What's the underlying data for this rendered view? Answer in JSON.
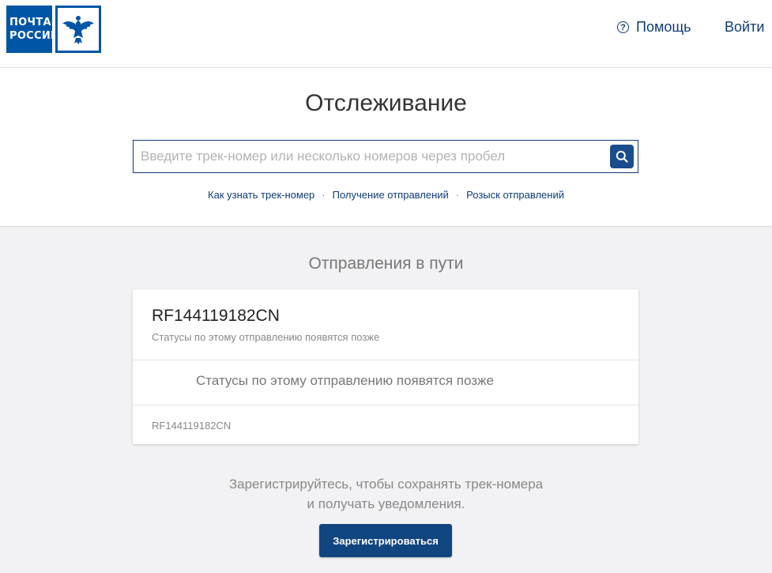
{
  "header": {
    "logo_line1": "ПОЧТА",
    "logo_line2": "РОССИИ",
    "help_label": "Помощь",
    "login_label": "Войти"
  },
  "tracking": {
    "title": "Отслеживание",
    "search_placeholder": "Введите трек-номер или несколько номеров через пробел",
    "links": [
      "Как узнать трек-номер",
      "Получение отправлений",
      "Розыск отправлений"
    ]
  },
  "shipments": {
    "section_title": "Отправления в пути",
    "card": {
      "track_number": "RF144119182CN",
      "status_short": "Статусы по этому отправлению появятся позже",
      "status_message": "Статусы по этому отправлению появятся позже",
      "footer_track": "RF144119182CN"
    }
  },
  "register": {
    "line1": "Зарегистрируйтесь, чтобы сохранять трек-номера",
    "line2": "и получать уведомления.",
    "button_label": "Зарегистрироваться"
  },
  "colors": {
    "brand_blue": "#0055a6",
    "link_blue": "#0d3b7a",
    "button_blue": "#11457f"
  }
}
